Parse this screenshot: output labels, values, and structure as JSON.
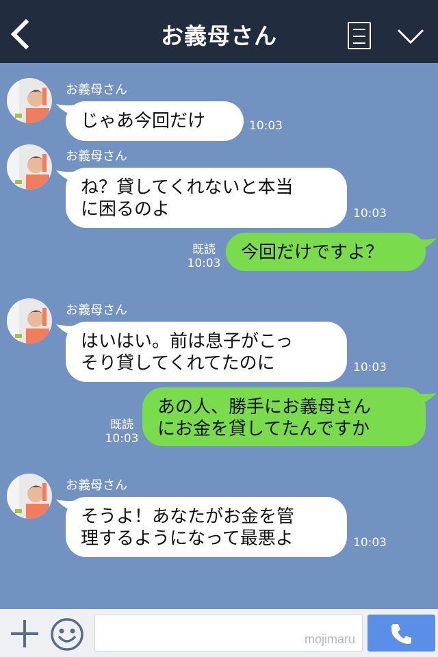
{
  "header": {
    "title": "お義母さん",
    "back_icon": "chevron-left-icon",
    "menu_icon": "list-icon",
    "collapse_icon": "chevron-down-icon"
  },
  "messages": [
    {
      "direction": "in",
      "sender": "お義母さん",
      "lines": [
        "じゃあ今回だけ"
      ],
      "time": "10:03"
    },
    {
      "direction": "in",
      "sender": "お義母さん",
      "lines": [
        "ね？貸してくれないと本当",
        "に困るのよ"
      ],
      "time": "10:03"
    },
    {
      "direction": "out",
      "lines": [
        "今回だけですよ？"
      ],
      "read": "既読",
      "time": "10:03"
    },
    {
      "direction": "in",
      "sender": "お義母さん",
      "lines": [
        "はいはい。前は息子がこっ",
        "そり貸してくれてたのに"
      ],
      "time": "10:03"
    },
    {
      "direction": "out",
      "lines": [
        "あの人、勝手にお義母さん",
        "にお金を貸してたんですか"
      ],
      "read": "既読",
      "time": "10:03"
    },
    {
      "direction": "in",
      "sender": "お義母さん",
      "lines": [
        "そうよ！あなたがお金を管",
        "理するようになって最悪よ"
      ],
      "time": "10:03"
    }
  ],
  "footer": {
    "input_value": "",
    "watermark": "mojimaru",
    "plus_icon": "plus-icon",
    "emoji_icon": "smiley-icon",
    "call_icon": "phone-icon"
  },
  "colors": {
    "header_bg": "#222c3f",
    "chat_bg": "#7293c2",
    "incoming_bubble": "#ffffff",
    "outgoing_bubble": "#7adb4d",
    "call_button": "#5b8ee6"
  }
}
